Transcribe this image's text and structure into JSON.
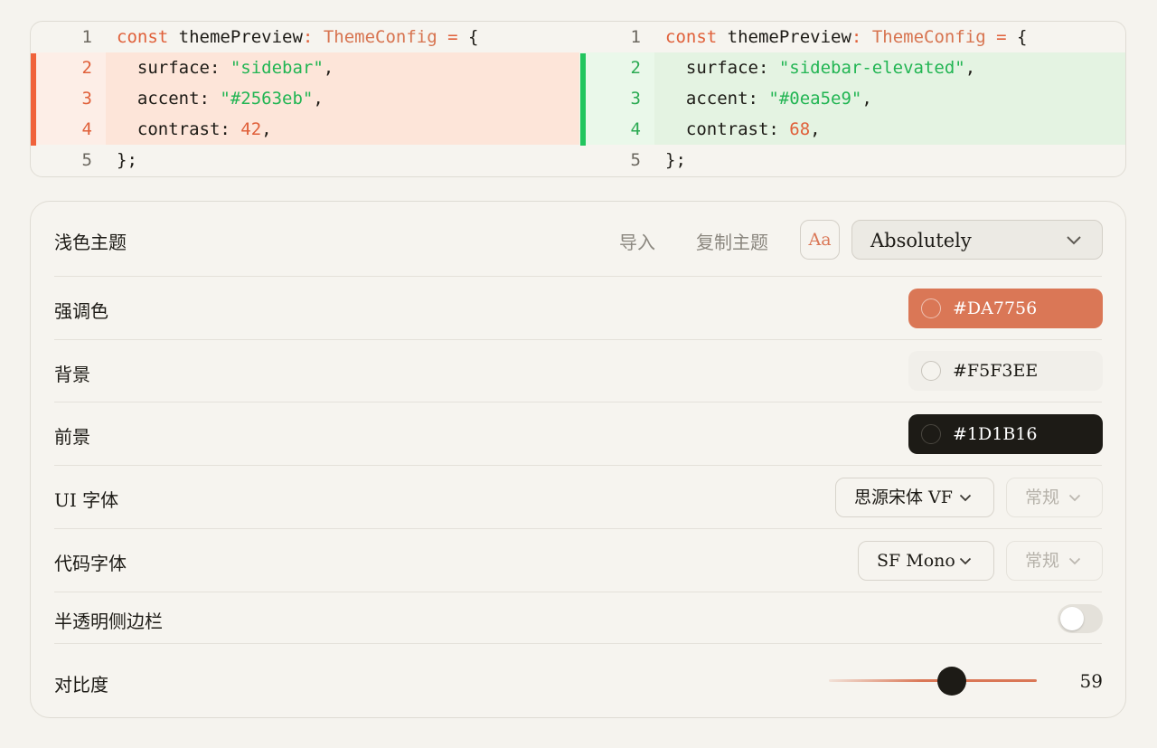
{
  "diff": {
    "left": {
      "lines": [
        {
          "n": "1",
          "kind": "ctx",
          "parts": [
            [
              "kw",
              "const"
            ],
            [
              "pl",
              " themePreview"
            ],
            [
              "kw",
              ":"
            ],
            [
              "pl",
              " "
            ],
            [
              "ty",
              "ThemeConfig"
            ],
            [
              "pl",
              " "
            ],
            [
              "kw",
              "="
            ],
            [
              "pl",
              " {"
            ]
          ]
        },
        {
          "n": "2",
          "kind": "del",
          "parts": [
            [
              "pl",
              "  surface: "
            ],
            [
              "str",
              "\"sidebar\""
            ],
            [
              "pl",
              ","
            ]
          ]
        },
        {
          "n": "3",
          "kind": "del",
          "parts": [
            [
              "pl",
              "  accent: "
            ],
            [
              "str",
              "\"#2563eb\""
            ],
            [
              "pl",
              ","
            ]
          ]
        },
        {
          "n": "4",
          "kind": "del",
          "parts": [
            [
              "pl",
              "  contrast: "
            ],
            [
              "numv",
              "42"
            ],
            [
              "pl",
              ","
            ]
          ]
        },
        {
          "n": "5",
          "kind": "ctx",
          "parts": [
            [
              "pl",
              "};"
            ]
          ]
        }
      ]
    },
    "right": {
      "lines": [
        {
          "n": "1",
          "kind": "ctx",
          "parts": [
            [
              "kw",
              "const"
            ],
            [
              "pl",
              " themePreview"
            ],
            [
              "kw",
              ":"
            ],
            [
              "pl",
              " "
            ],
            [
              "ty",
              "ThemeConfig"
            ],
            [
              "pl",
              " "
            ],
            [
              "kw",
              "="
            ],
            [
              "pl",
              " {"
            ]
          ]
        },
        {
          "n": "2",
          "kind": "add",
          "parts": [
            [
              "pl",
              "  surface: "
            ],
            [
              "str",
              "\"sidebar-elevated\""
            ],
            [
              "pl",
              ","
            ]
          ]
        },
        {
          "n": "3",
          "kind": "add",
          "parts": [
            [
              "pl",
              "  accent: "
            ],
            [
              "str",
              "\"#0ea5e9\""
            ],
            [
              "pl",
              ","
            ]
          ]
        },
        {
          "n": "4",
          "kind": "add",
          "parts": [
            [
              "pl",
              "  contrast: "
            ],
            [
              "numv",
              "68"
            ],
            [
              "pl",
              ","
            ]
          ]
        },
        {
          "n": "5",
          "kind": "ctx",
          "parts": [
            [
              "pl",
              "};"
            ]
          ]
        }
      ]
    }
  },
  "settings": {
    "theme": {
      "label": "浅色主题",
      "import_label": "导入",
      "copy_label": "复制主题",
      "font_preview": "Aa",
      "selected_theme": "Absolutely"
    },
    "accent": {
      "label": "强调色",
      "value": "#DA7756",
      "color": "#DA7756"
    },
    "background": {
      "label": "背景",
      "value": "#F5F3EE",
      "color": "#F5F3EE"
    },
    "foreground": {
      "label": "前景",
      "value": "#1D1B16",
      "display": "#1D1B16",
      "color": "#1D1B16"
    },
    "ui_font": {
      "label": "UI 字体",
      "family": "思源宋体 VF",
      "weight": "常规"
    },
    "code_font": {
      "label": "代码字体",
      "family": "SF Mono",
      "weight": "常规"
    },
    "translucent_sidebar": {
      "label": "半透明侧边栏",
      "enabled": false
    },
    "contrast": {
      "label": "对比度",
      "value": "59",
      "min": 0,
      "max": 100
    }
  }
}
